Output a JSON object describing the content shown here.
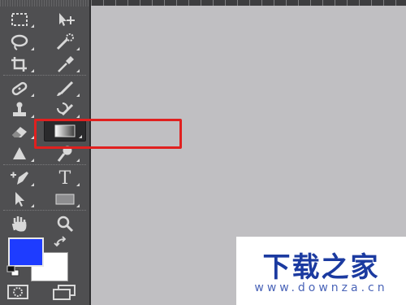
{
  "app": {
    "toolbar_name": "tools-panel"
  },
  "tools": [
    {
      "name": "rectangular-marquee-icon"
    },
    {
      "name": "move-icon"
    },
    {
      "name": "lasso-icon"
    },
    {
      "name": "quick-selection-icon"
    },
    {
      "name": "crop-icon"
    },
    {
      "name": "eyedropper-icon"
    },
    {
      "name": "healing-brush-icon"
    },
    {
      "name": "brush-icon"
    },
    {
      "name": "clone-stamp-icon"
    },
    {
      "name": "history-brush-icon"
    },
    {
      "name": "eraser-icon"
    },
    {
      "name": "gradient-icon",
      "active": true
    },
    {
      "name": "blur-icon"
    },
    {
      "name": "dodge-icon"
    },
    {
      "name": "pen-icon"
    },
    {
      "name": "type-icon",
      "label": "T"
    },
    {
      "name": "path-selection-icon"
    },
    {
      "name": "rectangle-shape-icon"
    },
    {
      "name": "hand-icon"
    },
    {
      "name": "zoom-icon"
    }
  ],
  "colors": {
    "foreground": "#1e3cff",
    "background": "#ffffff",
    "highlight": "#e0201f",
    "canvas": "#c0bfc2"
  },
  "watermark": {
    "title": "下载之家",
    "url": "www.downza.cn"
  }
}
